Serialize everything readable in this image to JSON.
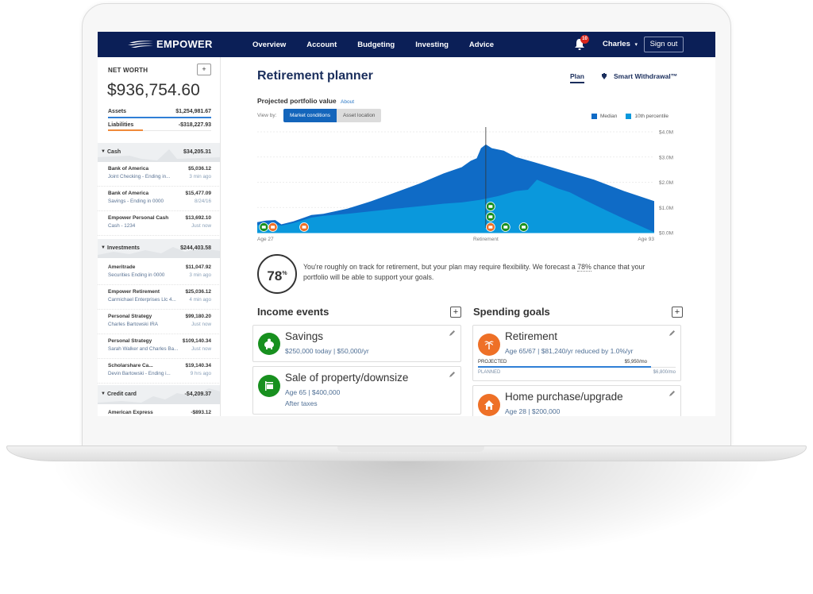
{
  "nav": {
    "brand": "EMPOWER",
    "links": [
      "Overview",
      "Account",
      "Budgeting",
      "Investing",
      "Advice"
    ],
    "notification_count": "10",
    "user": "Charles",
    "user_caret": "▾",
    "signout": "Sign out"
  },
  "sidebar": {
    "net_worth_label": "NET WORTH",
    "add_label": "+",
    "net_worth_value": "$936,754.60",
    "assets_label": "Assets",
    "assets_value": "$1,254,981.67",
    "liabilities_label": "Liabilities",
    "liabilities_value": "-$318,227.93",
    "groups": [
      {
        "label": "Cash",
        "value": "$34,205.31",
        "accounts": [
          {
            "name": "Bank of America",
            "value": "$5,036.12",
            "sub": "Joint Checking - Ending in...",
            "time": "3 min ago"
          },
          {
            "name": "Bank of America",
            "value": "$15,477.09",
            "sub": "Savings - Ending in 0000",
            "time": "8/24/16"
          },
          {
            "name": "Empower Personal Cash",
            "value": "$13,692.10",
            "sub": "Cash - 1234",
            "time": "Just now"
          }
        ]
      },
      {
        "label": "Investments",
        "value": "$244,403.58",
        "accounts": [
          {
            "name": "Ameritrade",
            "value": "$11,047.92",
            "sub": "Securities Ending in 0000",
            "time": "3 min ago"
          },
          {
            "name": "Empower Retirement",
            "value": "$25,036.12",
            "sub": "Carmichael Enterprises Llc 4...",
            "time": "4 min ago"
          },
          {
            "name": "Personal Strategy",
            "value": "$99,180.20",
            "sub": "Charles Bartowski IRA",
            "time": "Just now"
          },
          {
            "name": "Personal Strategy",
            "value": "$109,140.34",
            "sub": "Sarah Walker and Charles Ba...",
            "time": "Just now"
          },
          {
            "name": "Scholarshare Ca...",
            "value": "$19,140.34",
            "sub": "Devin Bartowski - Ending i...",
            "time": "9 hrs ago"
          }
        ]
      },
      {
        "label": "Credit card",
        "value": "-$4,209.37",
        "accounts": [
          {
            "name": "American Express",
            "value": "-$893.12",
            "sub": "",
            "time": ""
          }
        ]
      }
    ]
  },
  "main": {
    "title": "Retirement planner",
    "tabs": {
      "plan": "Plan",
      "smart_withdrawal": "Smart Withdrawal™"
    },
    "projected_label": "Projected portfolio value",
    "about_link": "About",
    "view_by_label": "View by:",
    "view_options": [
      "Market conditions",
      "Asset location"
    ],
    "selected_view": "Market conditions",
    "score": "78",
    "score_unit": "%",
    "summary_before": "You're roughly on track for retirement, but your plan may require flexibility. We forecast a ",
    "summary_pct": "78%",
    "summary_after": " chance that your portfolio will be able to support your goals.",
    "income_events": {
      "title": "Income events",
      "add_label": "+",
      "items": [
        {
          "title": "Savings",
          "lines": [
            "$250,000 today | $50,000/yr"
          ],
          "icon": "piggy-bank-icon",
          "color": "#18901f"
        },
        {
          "title": "Sale of property/downsize",
          "lines": [
            "Age 65 | $400,000",
            "After taxes"
          ],
          "icon": "for-sale-sign-icon",
          "color": "#18901f"
        }
      ]
    },
    "spending_goals": {
      "title": "Spending goals",
      "add_label": "+",
      "items": [
        {
          "title": "Retirement",
          "lines": [
            "Age 65/67 | $81,240/yr reduced by 1.0%/yr"
          ],
          "icon": "palm-tree-icon",
          "color": "#ee7027",
          "projected_label": "PROJECTED",
          "projected_value": "$5,950/mo",
          "planned_label": "PLANNED",
          "planned_value": "$6,800/mo",
          "projected_fraction": 0.875
        },
        {
          "title": "Home purchase/upgrade",
          "lines": [
            "Age 28 | $200,000"
          ],
          "icon": "house-icon",
          "color": "#ee7027"
        }
      ]
    }
  },
  "chart_data": {
    "type": "area",
    "title": "Projected portfolio value",
    "xlabel": "Age",
    "ylabel": "",
    "x_range": [
      27,
      93
    ],
    "ylim": [
      0,
      4.0
    ],
    "y_unit": "$M",
    "y_ticks": [
      "$0.0M",
      "$1.0M",
      "$2.0M",
      "$3.0M",
      "$4.0M"
    ],
    "x_labels": [
      {
        "age": 27,
        "label": "Age 27"
      },
      {
        "age": 65,
        "label": "Retirement"
      },
      {
        "age": 93,
        "label": "Age 93"
      }
    ],
    "grid": true,
    "legend_position": "top-right",
    "series": [
      {
        "name": "Median",
        "color": "#0f6bc6",
        "x": [
          27,
          28.5,
          30,
          31,
          33,
          36,
          38,
          42,
          46,
          50,
          54,
          58,
          61,
          62.5,
          63.5,
          64.2,
          65,
          66,
          68,
          70,
          73,
          78,
          83,
          88,
          93
        ],
        "values": [
          0.42,
          0.48,
          0.5,
          0.33,
          0.45,
          0.7,
          0.75,
          0.95,
          1.25,
          1.6,
          1.95,
          2.35,
          2.6,
          2.85,
          2.95,
          3.35,
          3.5,
          3.35,
          3.25,
          3.0,
          2.8,
          2.45,
          2.1,
          1.65,
          1.25
        ]
      },
      {
        "name": "10th percentile",
        "color": "#0a98dc",
        "x": [
          27,
          28.5,
          30,
          31,
          33,
          36,
          38,
          42,
          46,
          50,
          54,
          58,
          61,
          64,
          67,
          70,
          72,
          73.5,
          75,
          77,
          79,
          81,
          84,
          88,
          93
        ],
        "values": [
          0.3,
          0.35,
          0.33,
          0.28,
          0.38,
          0.6,
          0.67,
          0.75,
          0.85,
          0.95,
          1.05,
          1.15,
          1.2,
          1.3,
          1.45,
          1.65,
          1.7,
          2.1,
          1.95,
          1.75,
          1.6,
          1.35,
          1.0,
          0.55,
          0.02
        ]
      }
    ],
    "events": [
      {
        "age": 27.3,
        "level": 0,
        "color": "#18901f",
        "icon": "piggy-bank-icon"
      },
      {
        "age": 28.8,
        "level": 0,
        "color": "#ee7027",
        "icon": "house-icon"
      },
      {
        "age": 34.0,
        "level": 0,
        "color": "#ee7027",
        "icon": "car-icon"
      },
      {
        "age": 65,
        "level": 0,
        "color": "#ee7027",
        "icon": "palm-tree-icon"
      },
      {
        "age": 65,
        "level": 1,
        "color": "#18901f",
        "icon": "cash-icon"
      },
      {
        "age": 65,
        "level": 2,
        "color": "#18901f",
        "icon": "for-sale-sign-icon"
      },
      {
        "age": 67.5,
        "level": 0,
        "color": "#18901f",
        "icon": "cash-icon"
      },
      {
        "age": 70.5,
        "level": 0,
        "color": "#18901f",
        "icon": "cash-icon"
      }
    ],
    "marker_age": 65
  }
}
